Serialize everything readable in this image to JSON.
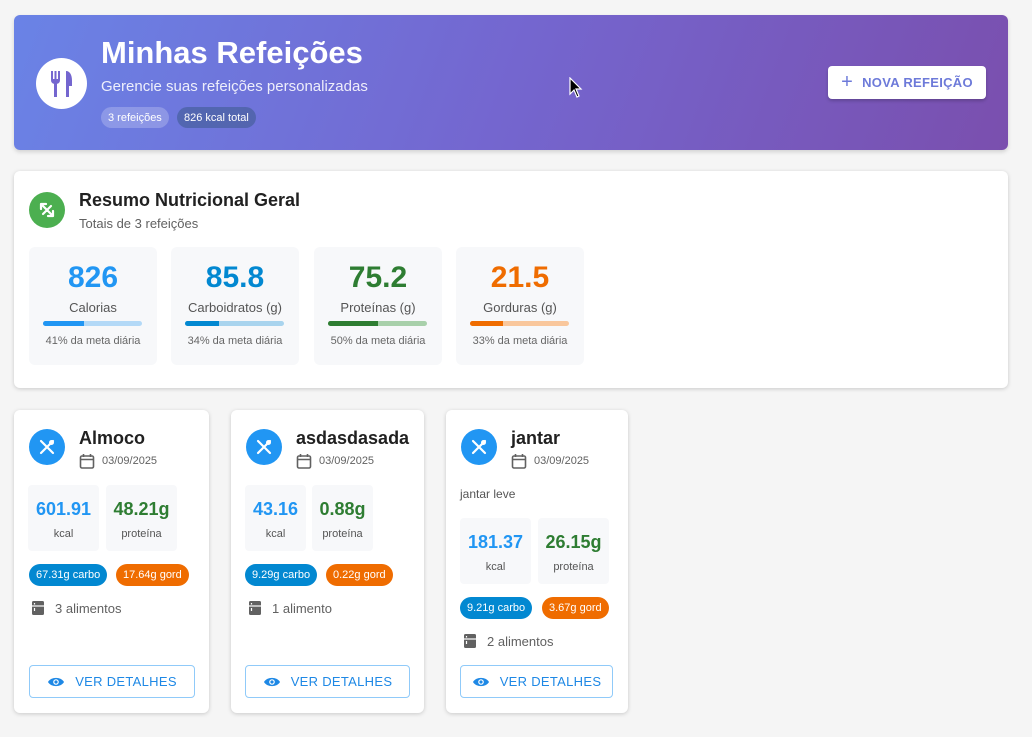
{
  "header": {
    "title": "Minhas Refeições",
    "subtitle": "Gerencie suas refeições personalizadas",
    "chip_meals": "3 refeições",
    "chip_kcal": "826 kcal total",
    "new_button": "NOVA REFEIÇÃO",
    "icon": "restaurant-icon"
  },
  "summary": {
    "title": "Resumo Nutricional Geral",
    "subtitle": "Totais de 3 refeições",
    "icon": "fitness-icon",
    "stats": [
      {
        "value": "826",
        "label": "Calorias",
        "goal": "41% da meta diária",
        "percent": 41,
        "color": "#2196f3",
        "track": "#b3d9f7"
      },
      {
        "value": "85.8",
        "label": "Carboidratos (g)",
        "goal": "34% da meta diária",
        "percent": 34,
        "color": "#0288d1",
        "track": "#a9d4ee"
      },
      {
        "value": "75.2",
        "label": "Proteínas (g)",
        "goal": "50% da meta diária",
        "percent": 50,
        "color": "#2e7d32",
        "track": "#a8d0aa"
      },
      {
        "value": "21.5",
        "label": "Gorduras (g)",
        "goal": "33% da meta diária",
        "percent": 33,
        "color": "#ef6c00",
        "track": "#f9c79c"
      }
    ]
  },
  "meals": [
    {
      "name": "Almoco",
      "date": "03/09/2025",
      "description": "",
      "kcal": "601.91",
      "kcal_label": "kcal",
      "protein": "48.21g",
      "protein_label": "proteína",
      "carbs": "67.31g carbo",
      "fat": "17.64g gord",
      "foods": "3 alimentos",
      "details_button": "VER DETALHES"
    },
    {
      "name": "asdasdasada",
      "date": "03/09/2025",
      "description": "",
      "kcal": "43.16",
      "kcal_label": "kcal",
      "protein": "0.88g",
      "protein_label": "proteína",
      "carbs": "9.29g carbo",
      "fat": "0.22g gord",
      "foods": "1 alimento",
      "details_button": "VER DETALHES"
    },
    {
      "name": "jantar",
      "date": "03/09/2025",
      "description": "jantar leve",
      "kcal": "181.37",
      "kcal_label": "kcal",
      "protein": "26.15g",
      "protein_label": "proteína",
      "carbs": "9.21g carbo",
      "fat": "3.67g gord",
      "foods": "2 alimentos",
      "details_button": "VER DETALHES"
    }
  ],
  "colors": {
    "kcal": "#2196f3",
    "protein": "#2e7d32",
    "accent": "#6d7ad9"
  }
}
